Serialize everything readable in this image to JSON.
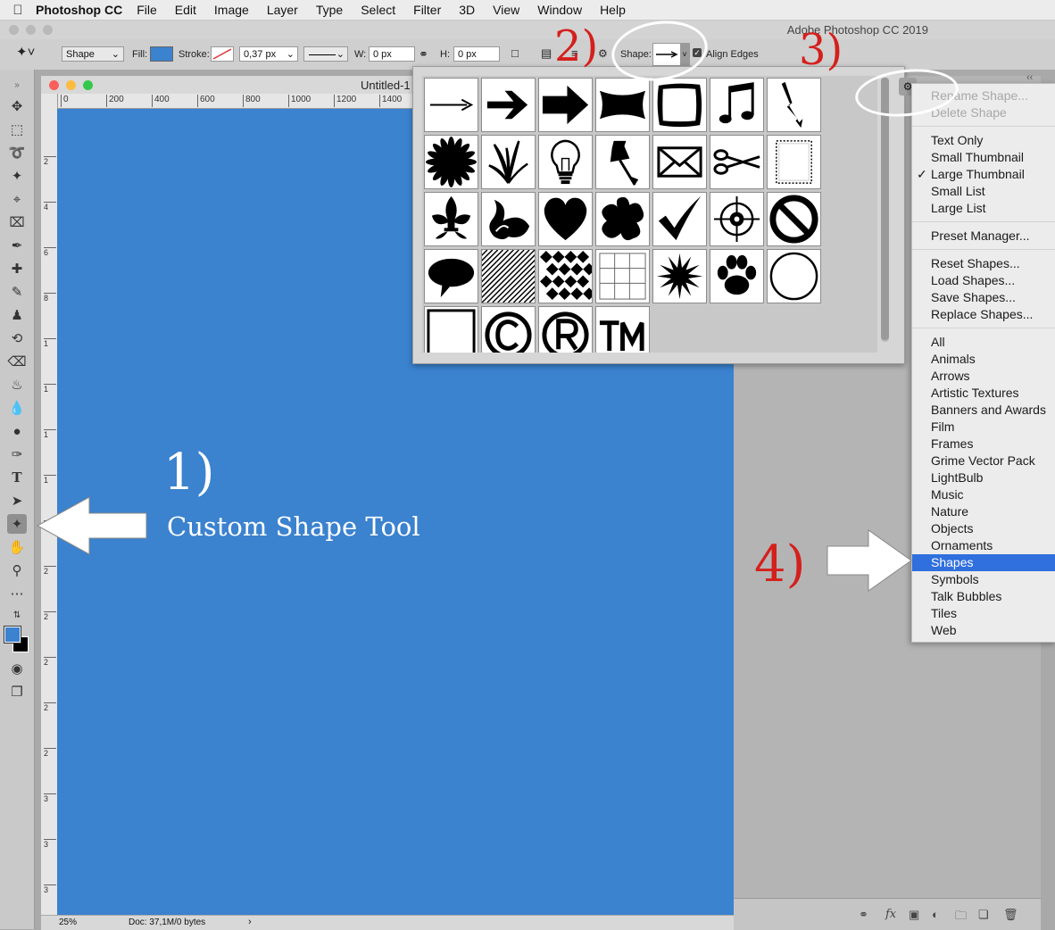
{
  "menubar": {
    "app_name": "Photoshop CC",
    "items": [
      "File",
      "Edit",
      "Image",
      "Layer",
      "Type",
      "Select",
      "Filter",
      "3D",
      "View",
      "Window",
      "Help"
    ]
  },
  "window": {
    "title": "Adobe Photoshop CC 2019"
  },
  "options_bar": {
    "mode": "Shape",
    "fill_label": "Fill:",
    "fill_color": "#3b82cf",
    "stroke_label": "Stroke:",
    "stroke_width": "0,37 px",
    "w_label": "W:",
    "w_value": "0 px",
    "h_label": "H:",
    "h_value": "0 px",
    "shape_label": "Shape:",
    "align_edges": "Align Edges"
  },
  "document": {
    "title": "Untitled-1",
    "zoom": "25%",
    "doc_info": "Doc: 37,1M/0 bytes",
    "ruler_h": [
      "0",
      "200",
      "400",
      "600",
      "800",
      "1000",
      "1200",
      "1400"
    ],
    "ruler_v": [
      "2",
      "4",
      "6",
      "8",
      "1",
      "1",
      "1",
      "1",
      "1",
      "2",
      "2",
      "2",
      "2",
      "2",
      "3",
      "3",
      "3"
    ]
  },
  "shape_picker": {
    "shapes": [
      "arrow-thin",
      "arrow-medium",
      "arrow-bold",
      "banner",
      "grime-frame",
      "music-notes",
      "lightning",
      "starburst-flower",
      "grass",
      "lightbulb",
      "pushpin",
      "envelope",
      "scissors",
      "stamp-frame",
      "fleur-de-lis",
      "ornament-leaf",
      "heart",
      "splat",
      "checkmark",
      "target",
      "no-symbol",
      "talk-bubble",
      "diagonal-lines",
      "diamond-tiles",
      "grid-tiles",
      "burst",
      "paw-print",
      "circle",
      "square-frame",
      "copyright",
      "registered",
      "trademark"
    ]
  },
  "menu": {
    "items": [
      {
        "label": "Rename Shape...",
        "disabled": true
      },
      {
        "label": "Delete Shape",
        "disabled": true
      },
      {
        "label": "Text Only"
      },
      {
        "label": "Small Thumbnail"
      },
      {
        "label": "Large Thumbnail",
        "checked": true
      },
      {
        "label": "Small List"
      },
      {
        "label": "Large List"
      },
      {
        "label": "Preset Manager..."
      },
      {
        "label": "Reset Shapes..."
      },
      {
        "label": "Load Shapes..."
      },
      {
        "label": "Save Shapes..."
      },
      {
        "label": "Replace Shapes..."
      },
      {
        "label": "All"
      },
      {
        "label": "Animals"
      },
      {
        "label": "Arrows"
      },
      {
        "label": "Artistic Textures"
      },
      {
        "label": "Banners and Awards"
      },
      {
        "label": "Film"
      },
      {
        "label": "Frames"
      },
      {
        "label": "Grime Vector Pack"
      },
      {
        "label": "LightBulb"
      },
      {
        "label": "Music"
      },
      {
        "label": "Nature"
      },
      {
        "label": "Objects"
      },
      {
        "label": "Ornaments"
      },
      {
        "label": "Shapes",
        "selected": true
      },
      {
        "label": "Symbols"
      },
      {
        "label": "Talk Bubbles"
      },
      {
        "label": "Tiles"
      },
      {
        "label": "Web"
      }
    ]
  },
  "annotations": {
    "step1": "1)",
    "step1_caption": "Custom Shape Tool",
    "step2": "2)",
    "step3": "3)",
    "step4": "4)"
  },
  "colors": {
    "canvas": "#3b82cf",
    "highlight": "#2f6fde",
    "annotation_red": "#d4201c"
  }
}
